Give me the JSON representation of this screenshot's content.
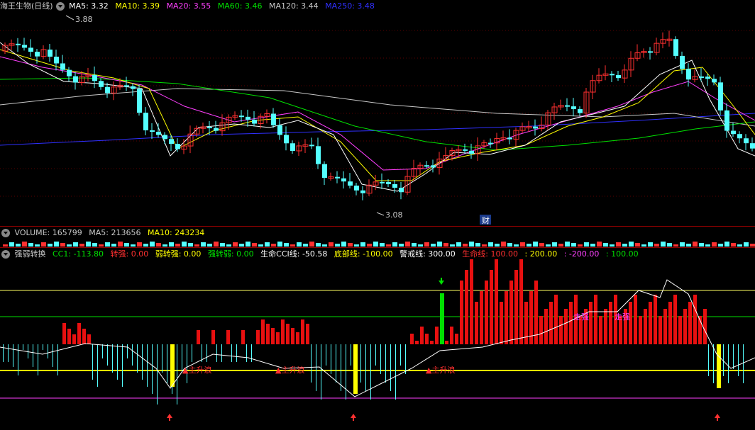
{
  "header": {
    "stock_name": "海王生物(日线)",
    "ma5": "MA5: 3.32",
    "ma10": "MA10: 3.39",
    "ma20": "MA20: 3.55",
    "ma60": "MA60: 3.46",
    "ma120": "MA120: 3.44",
    "ma250": "MA250: 3.48",
    "high_label": "3.88",
    "low_label": "3.08",
    "fin_marker": "财"
  },
  "volume_bar": {
    "volume": "VOLUME: 165799",
    "ma5": "MA5: 213656",
    "ma10": "MA10: 243234"
  },
  "indicator_bar": {
    "name": "强弱转换",
    "cc1": "CC1: -113.80",
    "zhuanqiang": "转强: 0.00",
    "ruozhuanqiang": "弱转强: 0.00",
    "qiangzhuanruo": "强转弱: 0.00",
    "shengming_cci": "生命CCI线: -50.58",
    "dibuxian": "底部线: -100.00",
    "jingjiexian": "警戒线: 300.00",
    "shengmingxian": "生命线: 100.00",
    "v200": ": 200.00",
    "vneg200": ": -200.00",
    "v100": ": 100.00",
    "zhushengji": "主升浪",
    "tiqiang": "走强"
  },
  "colors": {
    "ma5": "#ffffff",
    "ma10": "#ffff00",
    "ma20": "#ff40ff",
    "ma60": "#00e000",
    "ma120": "#c8c8c8",
    "ma250": "#3030ff",
    "up": "#ff3030",
    "down": "#54ffff"
  }
}
